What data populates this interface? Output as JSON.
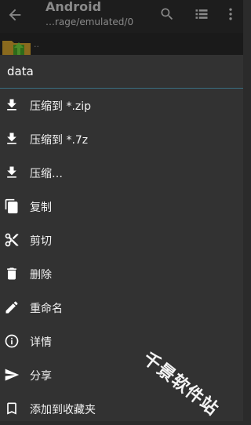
{
  "appbar": {
    "title": "Android",
    "path": "…rage/emulated/0",
    "back_icon": "arrow-left-icon",
    "actions": [
      "search-icon",
      "list-view-icon",
      "more-vert-icon"
    ]
  },
  "background_list": {
    "parent_label": ".."
  },
  "sheet": {
    "file_name": "data",
    "items": [
      {
        "label": "压缩到 *.zip",
        "icon": "download-icon"
      },
      {
        "label": "压缩到 *.7z",
        "icon": "download-icon"
      },
      {
        "label": "压缩…",
        "icon": "download-icon"
      },
      {
        "label": "复制",
        "icon": "copy-icon"
      },
      {
        "label": "剪切",
        "icon": "scissors-icon"
      },
      {
        "label": "删除",
        "icon": "trash-icon"
      },
      {
        "label": "重命名",
        "icon": "pencil-icon"
      },
      {
        "label": "详情",
        "icon": "info-icon"
      },
      {
        "label": "分享",
        "icon": "send-icon"
      },
      {
        "label": "添加到收藏夹",
        "icon": "bookmark-icon"
      }
    ]
  },
  "watermark": "千景软件站",
  "colors": {
    "sheet_bg": "#323232",
    "divider": "#3a6f82",
    "appbar_bg": "#1d1d1d"
  }
}
